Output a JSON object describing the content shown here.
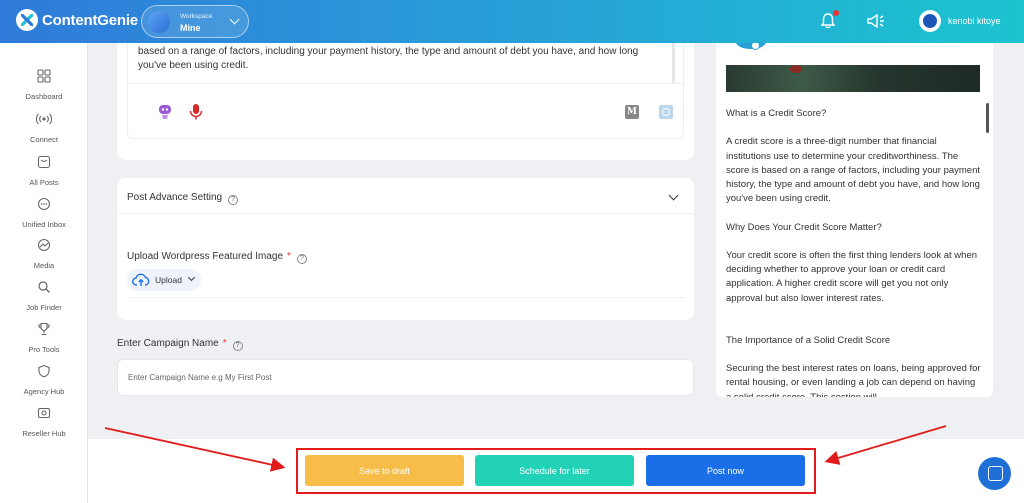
{
  "app": {
    "name": "ContentGenie"
  },
  "workspace": {
    "label": "Workspace",
    "name": "Mine"
  },
  "user": {
    "name": "kenobi kitoye"
  },
  "sidebar": {
    "items": [
      {
        "label": "Dashboard",
        "icon": "dashboard-icon"
      },
      {
        "label": "Connect",
        "icon": "connect-icon"
      },
      {
        "label": "All Posts",
        "icon": "all-posts-icon"
      },
      {
        "label": "Unified Inbox",
        "icon": "inbox-icon"
      },
      {
        "label": "Media",
        "icon": "media-icon"
      },
      {
        "label": "Job Finder",
        "icon": "job-finder-icon"
      },
      {
        "label": "Pro Tools",
        "icon": "trophy-icon"
      },
      {
        "label": "Agency Hub",
        "icon": "agency-hub-icon"
      },
      {
        "label": "Reseller Hub",
        "icon": "reseller-hub-icon"
      }
    ]
  },
  "editor": {
    "text": "based on a range of factors, including your payment history, the type and amount of debt you have, and how long you've been using credit.",
    "m_label": "M"
  },
  "advance": {
    "title": "Post Advance Setting",
    "help": "?",
    "upload_label": "Upload Wordpress Featured Image",
    "required_mark": "*",
    "upload_button": "Upload"
  },
  "campaign": {
    "label": "Enter Campaign Name",
    "required_mark": "*",
    "help": "?",
    "placeholder": "Enter Campaign Name e.g My First Post"
  },
  "preview": {
    "paragraphs": [
      "What is a Credit Score?",
      "A credit score is a three-digit number that financial institutions use to determine your creditworthiness. The score is based on a range of factors, including your payment history, the type and amount of debt you have, and how long you've been using credit.",
      "Why Does Your Credit Score Matter?",
      "Your credit score is often the first thing lenders look at when deciding whether to approve your loan or credit card application. A higher credit score will get you not only approval but also lower interest rates.",
      "The Importance of a Solid Credit Score",
      "Securing the best interest rates on loans, being approved for rental housing, or even landing a job can depend on having a solid credit score. This section will"
    ]
  },
  "actions": {
    "save_draft": "Save to draft",
    "schedule": "Schedule for later",
    "post_now": "Post now"
  },
  "colors": {
    "draft": "#f8bd48",
    "schedule": "#22d2b7",
    "post": "#1a6ee8",
    "highlight": "#e21b1b"
  }
}
